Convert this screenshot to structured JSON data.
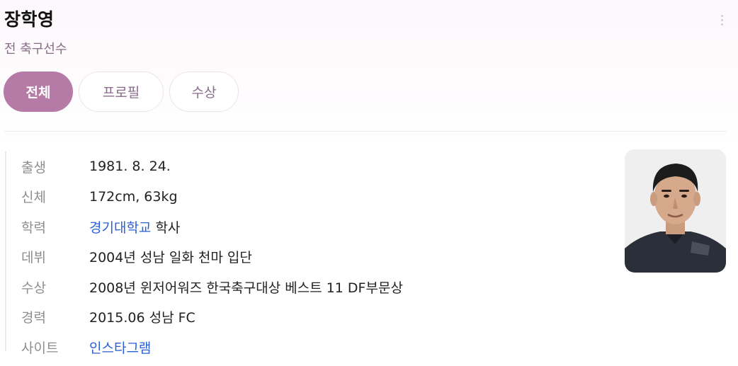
{
  "profile": {
    "name": "장학영",
    "role": "전 축구선수"
  },
  "tabs": [
    {
      "label": "전체",
      "active": true
    },
    {
      "label": "프로필",
      "active": false
    },
    {
      "label": "수상",
      "active": false
    }
  ],
  "info": {
    "birth": {
      "label": "출생",
      "value": "1981. 8. 24."
    },
    "body": {
      "label": "신체",
      "value": "172cm, 63kg"
    },
    "education": {
      "label": "학력",
      "link": "경기대학교",
      "suffix": " 학사"
    },
    "debut": {
      "label": "데뷔",
      "value": "2004년 성남 일화 천마 입단"
    },
    "award": {
      "label": "수상",
      "value": "2008년 윈저어워즈 한국축구대상 베스트 11 DF부문상"
    },
    "career": {
      "label": "경력",
      "value": "2015.06 성남 FC"
    },
    "site": {
      "label": "사이트",
      "link": "인스타그램"
    }
  },
  "icons": {
    "more": "more-vertical-icon"
  },
  "colors": {
    "accent": "#b57ba6",
    "link": "#2a5fd6",
    "role_text": "#8a6b8a"
  }
}
